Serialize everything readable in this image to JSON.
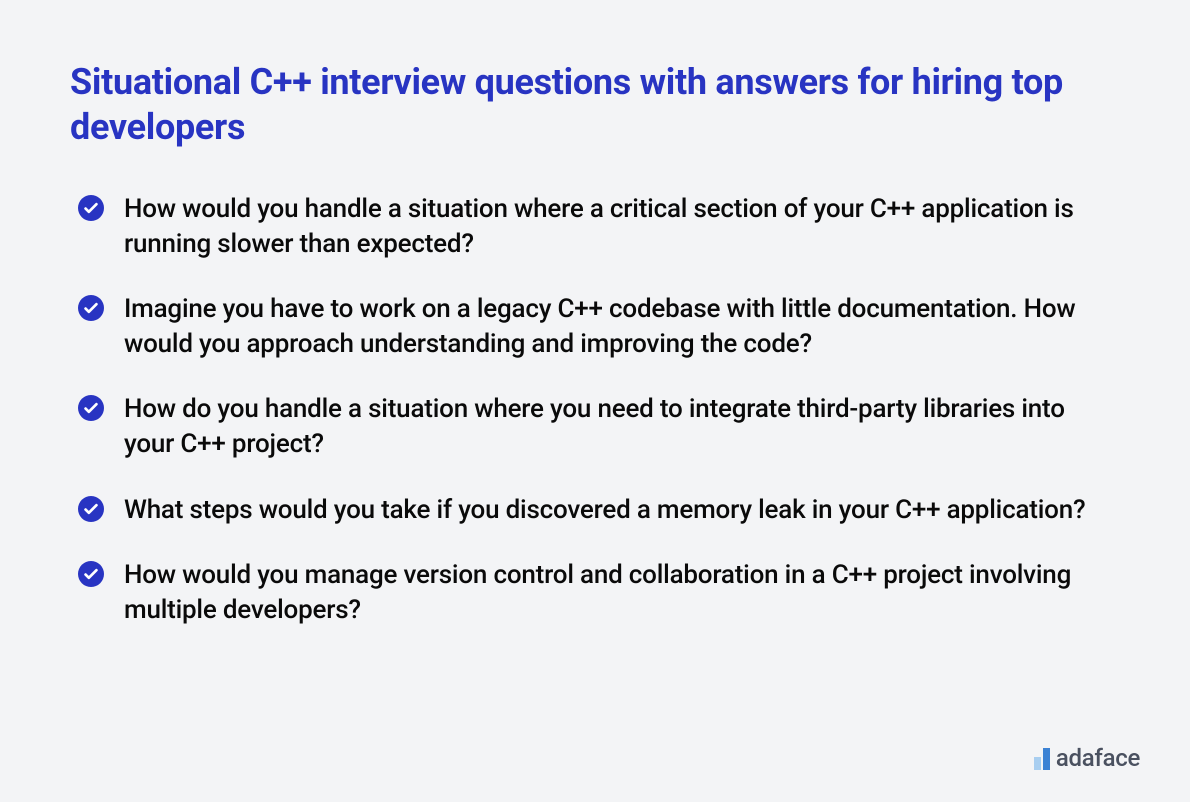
{
  "heading": "Situational C++ interview questions with answers for hiring top developers",
  "items": [
    "How would you handle a situation where a critical section of your C++ application is running slower than expected?",
    "Imagine you have to work on a legacy C++ codebase with little documentation. How would you approach understanding and improving the code?",
    "How do you handle a situation where you need to integrate third-party libraries into your C++ project?",
    "What steps would you take if you discovered a memory leak in your C++ application?",
    "How would you manage version control and collaboration in a C++ project involving multiple developers?"
  ],
  "logo_text": "adaface"
}
